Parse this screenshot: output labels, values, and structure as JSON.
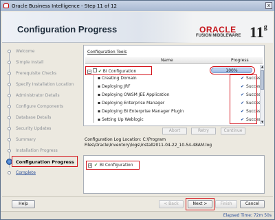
{
  "window": {
    "title": "Oracle Business Intelligence - Step 11 of 12",
    "close_glyph": "x"
  },
  "header": {
    "page_title": "Configuration Progress",
    "brand": "ORACLE",
    "product": "FUSION MIDDLEWARE",
    "version": "11",
    "version_sup": "g"
  },
  "steps": [
    {
      "label": "Welcome",
      "state": "done"
    },
    {
      "label": "Simple Install",
      "state": "done"
    },
    {
      "label": "Prerequisite Checks",
      "state": "done"
    },
    {
      "label": "Specify Installation Location",
      "state": "done"
    },
    {
      "label": "Administrator Details",
      "state": "done"
    },
    {
      "label": "Configure Components",
      "state": "done"
    },
    {
      "label": "Database Details",
      "state": "done"
    },
    {
      "label": "Security Updates",
      "state": "done"
    },
    {
      "label": "Summary",
      "state": "done"
    },
    {
      "label": "Installation Progress",
      "state": "done"
    },
    {
      "label": "Configuration Progress",
      "state": "active"
    },
    {
      "label": "Complete",
      "state": "link"
    }
  ],
  "tools": {
    "caption": "Configuration Tools",
    "col_name": "Name",
    "col_progress": "Progress",
    "root": {
      "label": "BI Configuration",
      "progress": "100%"
    },
    "items": [
      {
        "name": "Creating Domain",
        "status": "Success"
      },
      {
        "name": "Deploying JRF",
        "status": "Success"
      },
      {
        "name": "Deploying OWSM JEE Application",
        "status": "Success"
      },
      {
        "name": "Deploying Enterprise Manager",
        "status": "Success"
      },
      {
        "name": "Deploying BI Enterprise Manager Plugin",
        "status": "Success"
      },
      {
        "name": "Setting Up Weblogic",
        "status": "Success"
      }
    ]
  },
  "action_buttons": {
    "abort": "Abort",
    "retry": "Retry",
    "continue": "Continue"
  },
  "log": {
    "line1": "Configuration Log Location: C:\\Program",
    "line2": "Files\\Oracle\\Inventory\\logs\\install2011-04-22_10-54-48AM.log",
    "tree_label": "BI Configuration"
  },
  "footer": {
    "help": "Help",
    "back": "< Back",
    "next": "Next >",
    "finish": "Finish",
    "cancel": "Cancel"
  },
  "status": {
    "elapsed": "Elapsed Time: 72m 50s"
  },
  "colors": {
    "highlight": "#d4131b",
    "oracle_red": "#c4141a",
    "success_blue": "#1e4fa0"
  }
}
